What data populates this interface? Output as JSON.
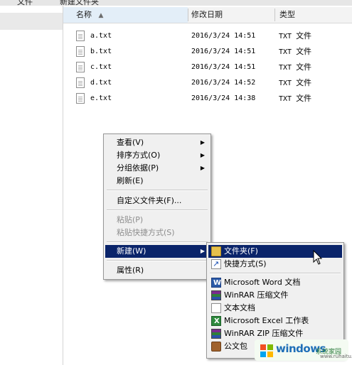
{
  "top_strip": {
    "left_fragment": "文件",
    "path_fragment": "新建文件夹"
  },
  "columns": {
    "name": "名称",
    "modified": "修改日期",
    "type": "类型"
  },
  "files": [
    {
      "name": "a.txt",
      "modified": "2016/3/24 14:51",
      "type_ext": "TXT",
      "type_word": "文件"
    },
    {
      "name": "b.txt",
      "modified": "2016/3/24 14:51",
      "type_ext": "TXT",
      "type_word": "文件"
    },
    {
      "name": "c.txt",
      "modified": "2016/3/24 14:51",
      "type_ext": "TXT",
      "type_word": "文件"
    },
    {
      "name": "d.txt",
      "modified": "2016/3/24 14:52",
      "type_ext": "TXT",
      "type_word": "文件"
    },
    {
      "name": "e.txt",
      "modified": "2016/3/24 14:38",
      "type_ext": "TXT",
      "type_word": "文件"
    }
  ],
  "context_menu": {
    "view": "查看(V)",
    "sort": "排序方式(O)",
    "group": "分组依据(P)",
    "refresh": "刷新(E)",
    "customize": "自定义文件夹(F)...",
    "paste": "粘贴(P)",
    "paste_shortcut": "粘贴快捷方式(S)",
    "new": "新建(W)",
    "properties": "属性(R)"
  },
  "new_submenu": {
    "folder": "文件夹(F)",
    "shortcut": "快捷方式(S)",
    "word": "Microsoft Word 文档",
    "winrar": "WinRAR 压缩文件",
    "text": "文本文档",
    "excel": "Microsoft Excel 工作表",
    "winrar_zip": "WinRAR ZIP 压缩文件",
    "briefcase": "公文包"
  },
  "watermark": {
    "brand": "windows",
    "sub": "系统家园",
    "url": "www.ruhaitu.com"
  },
  "colors": {
    "highlight": "#0a246a",
    "menu_bg": "#f0f0f0",
    "header_bg": "#f3f3f3"
  },
  "icons": {
    "file": "text-file-icon",
    "folder": "folder-icon",
    "shortcut": "shortcut-icon"
  }
}
